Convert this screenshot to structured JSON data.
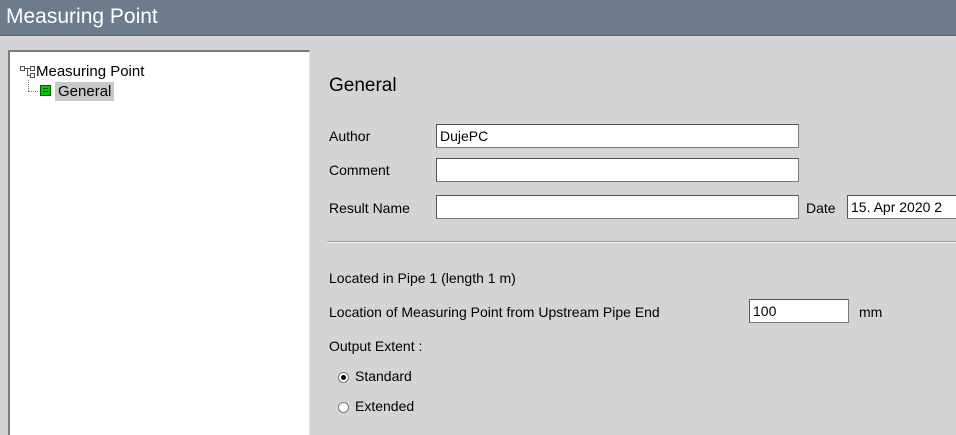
{
  "window": {
    "title": "Measuring Point"
  },
  "tree": {
    "root_label": "Measuring Point",
    "items": [
      {
        "label": "General",
        "selected": true
      }
    ]
  },
  "general": {
    "heading": "General",
    "author": {
      "label": "Author",
      "value": "DujePC"
    },
    "comment": {
      "label": "Comment",
      "value": ""
    },
    "result_name": {
      "label": "Result Name",
      "value": ""
    },
    "date": {
      "label": "Date",
      "value": "15. Apr 2020 2"
    },
    "located_in": "Located in Pipe 1 (length 1 m)",
    "location": {
      "label": "Location of Measuring Point from Upstream Pipe End",
      "value": "100",
      "unit": "mm"
    },
    "output_extent": {
      "label": "Output Extent :",
      "options": [
        {
          "label": "Standard",
          "selected": true
        },
        {
          "label": "Extended",
          "selected": false
        }
      ]
    }
  }
}
